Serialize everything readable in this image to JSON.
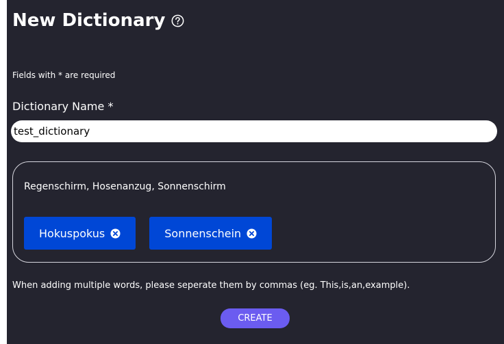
{
  "header": {
    "title": "New Dictionary",
    "help_icon": "help-circle-icon"
  },
  "form": {
    "required_note": "Fields with * are required",
    "name_label": "Dictionary Name *",
    "name_value": "test_dictionary",
    "words_value": "Regenschirm, Hosenanzug, Sonnenschirm",
    "chips": [
      {
        "label": "Hokuspokus",
        "remove_icon": "remove-circle-icon"
      },
      {
        "label": "Sonnenschein",
        "remove_icon": "remove-circle-icon"
      }
    ],
    "hint": "When adding multiple words, please seperate them by commas (eg. This,is,an,example).",
    "create_label": "CREATE"
  },
  "colors": {
    "background": "#24242f",
    "chip": "#0047d6",
    "button": "#6b5cf0"
  }
}
